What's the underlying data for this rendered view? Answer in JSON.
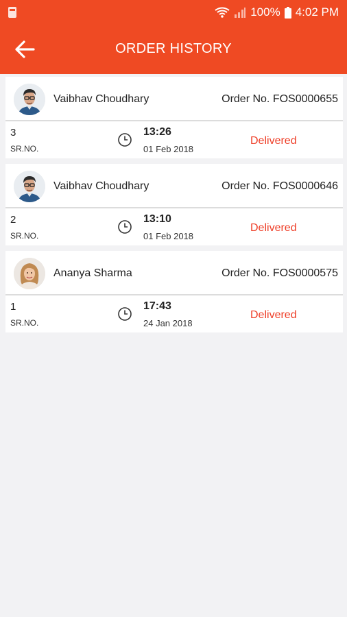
{
  "status_bar": {
    "battery_percent": "100%",
    "time": "4:02 PM"
  },
  "app_bar": {
    "title": "ORDER HISTORY",
    "back_icon": "arrow-left-icon"
  },
  "colors": {
    "brand": "#ef4a23",
    "status_delivered": "#ee3b24"
  },
  "orders": [
    {
      "customer": "Vaibhav Choudhary",
      "order_no": "Order No. FOS0000655",
      "sr": "3",
      "sr_label": "SR.NO.",
      "time": "13:26",
      "date": "01 Feb 2018",
      "status": "Delivered",
      "avatar": "male-avatar"
    },
    {
      "customer": "Vaibhav Choudhary",
      "order_no": "Order No. FOS0000646",
      "sr": "2",
      "sr_label": "SR.NO.",
      "time": "13:10",
      "date": "01 Feb 2018",
      "status": "Delivered",
      "avatar": "male-avatar"
    },
    {
      "customer": "Ananya Sharma",
      "order_no": "Order No. FOS0000575",
      "sr": "1",
      "sr_label": "SR.NO.",
      "time": "17:43",
      "date": "24 Jan 2018",
      "status": "Delivered",
      "avatar": "female-avatar"
    }
  ]
}
